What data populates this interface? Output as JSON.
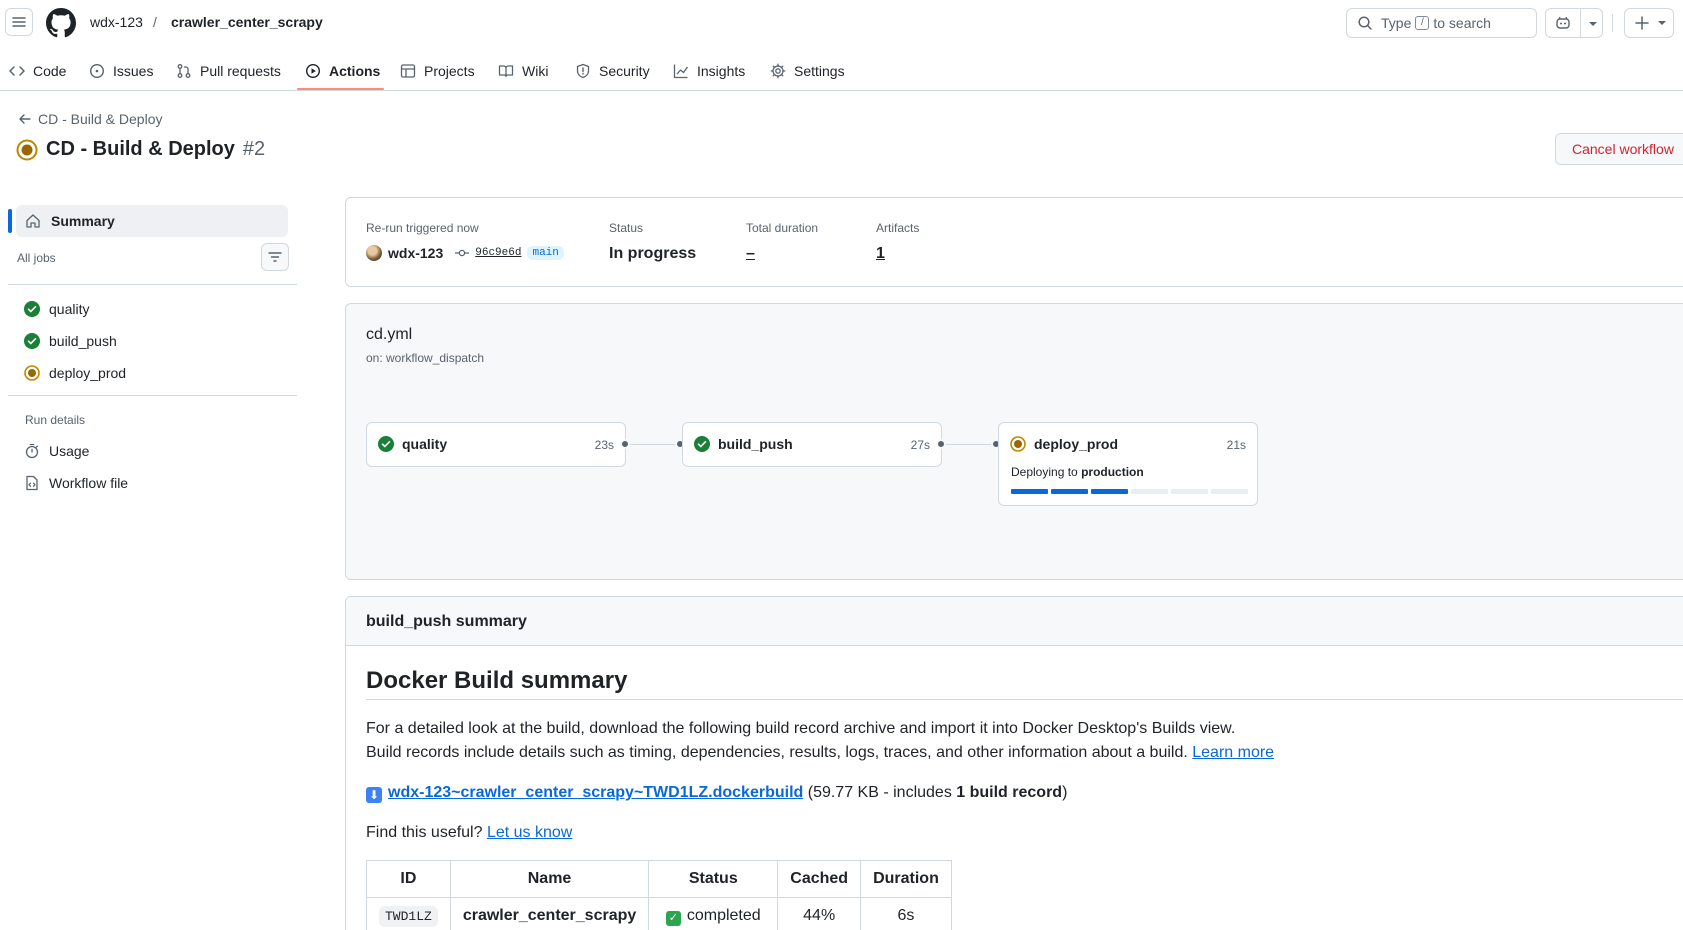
{
  "header": {
    "owner": "wdx-123",
    "separator": "/",
    "repo": "crawler_center_scrapy",
    "search_prefix": "Type",
    "search_key": "/",
    "search_suffix": "to search"
  },
  "nav": {
    "tabs": [
      {
        "label": "Code",
        "icon": "code-icon"
      },
      {
        "label": "Issues",
        "icon": "issue-opened-icon"
      },
      {
        "label": "Pull requests",
        "icon": "git-pull-request-icon"
      },
      {
        "label": "Actions",
        "icon": "play-icon",
        "active": true
      },
      {
        "label": "Projects",
        "icon": "table-icon"
      },
      {
        "label": "Wiki",
        "icon": "book-icon"
      },
      {
        "label": "Security",
        "icon": "shield-icon"
      },
      {
        "label": "Insights",
        "icon": "graph-icon"
      },
      {
        "label": "Settings",
        "icon": "gear-icon"
      }
    ]
  },
  "run": {
    "back_label": "CD - Build & Deploy",
    "title": "CD - Build & Deploy",
    "number": "#2",
    "cancel_label": "Cancel workflow"
  },
  "sidebar": {
    "summary_label": "Summary",
    "all_jobs_label": "All jobs",
    "jobs": [
      {
        "label": "quality",
        "status": "success"
      },
      {
        "label": "build_push",
        "status": "success"
      },
      {
        "label": "deploy_prod",
        "status": "in_progress"
      }
    ],
    "run_details_label": "Run details",
    "details": [
      {
        "label": "Usage",
        "icon": "stopwatch-icon"
      },
      {
        "label": "Workflow file",
        "icon": "file-code-icon"
      }
    ]
  },
  "meta": {
    "trigger_label": "Re-run triggered now",
    "actor": "wdx-123",
    "sha": "96c9e6d",
    "branch": "main",
    "status_label": "Status",
    "status_value": "In progress",
    "duration_label": "Total duration",
    "duration_value": "–",
    "artifacts_label": "Artifacts",
    "artifacts_value": "1"
  },
  "graph": {
    "file": "cd.yml",
    "trigger": "on: workflow_dispatch",
    "jobs": [
      {
        "name": "quality",
        "time": "23s",
        "status": "success"
      },
      {
        "name": "build_push",
        "time": "27s",
        "status": "success"
      },
      {
        "name": "deploy_prod",
        "time": "21s",
        "status": "in_progress"
      }
    ],
    "deploy_prefix": "Deploying to",
    "deploy_env": "production",
    "progress_fraction": 0.5
  },
  "summary": {
    "header": "build_push summary",
    "heading": "Docker Build summary",
    "para1": "For a detailed look at the build, download the following build record archive and import it into Docker Desktop's Builds view.",
    "para2": "Build records include details such as timing, dependencies, results, logs, traces, and other information about a build.",
    "learn_more": "Learn more",
    "download_link": "wdx-123~crawler_center_scrapy~TWD1LZ.dockerbuild",
    "download_meta_prefix": "(59.77 KB - includes",
    "download_meta_bold": "1 build record",
    "download_meta_suffix": ")",
    "useful_prefix": "Find this useful?",
    "useful_link": "Let us know",
    "table": {
      "headers": [
        "ID",
        "Name",
        "Status",
        "Cached",
        "Duration"
      ],
      "rows": [
        {
          "id": "TWD1LZ",
          "name": "crawler_center_scrapy",
          "status": "completed",
          "cached": "44%",
          "duration": "6s"
        }
      ]
    }
  },
  "colors": {
    "success": "#1a7f37",
    "in_progress": "#bf8700",
    "accent": "#0969da",
    "danger": "#d1242f",
    "nav_underline": "#fd8c73"
  }
}
